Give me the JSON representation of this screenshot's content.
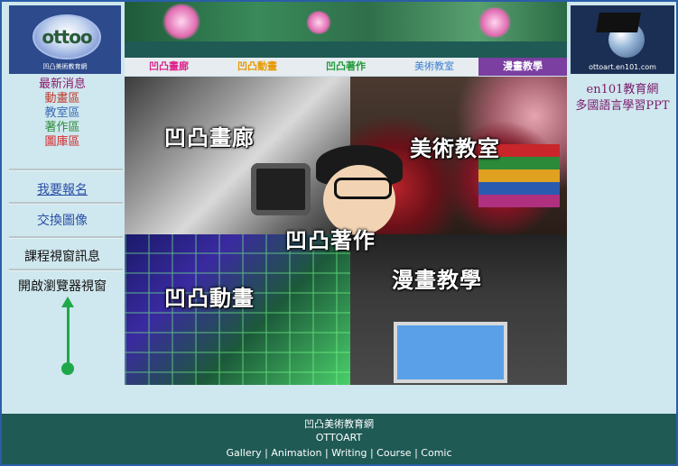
{
  "left_sidebar": {
    "logo_text": "ottoo",
    "logo_caption": "凹凸美術教育網",
    "nav": {
      "latest": "最新消息",
      "animation": "動畫區",
      "classroom": "教室區",
      "works": "著作區",
      "gallery": "圖庫區"
    },
    "signup": "我要報名",
    "exchange": "交換圖像",
    "course_window_msg": "課程視窗訊息",
    "open_browser_window": "開啟瀏覽器視窗"
  },
  "tabs": [
    "凹凸畫廊",
    "凹凸動畫",
    "凹凸著作",
    "美術教室",
    "漫畫教學"
  ],
  "hero": {
    "labels": [
      "凹凸畫廊",
      "美術教室",
      "凹凸著作",
      "凹凸動畫",
      "漫畫教學"
    ]
  },
  "right_sidebar": {
    "logo_caption": "ottoart.en101.com",
    "link1": "en101教育網",
    "link2": "多國語言學習PPT"
  },
  "footer": {
    "line1": "凹凸美術教育網",
    "line2": "OTTOART",
    "links": [
      "Gallery",
      "Animation",
      "Writing",
      "Course",
      "Comic"
    ],
    "separator": " | "
  },
  "colors": {
    "accent_arrow": "#1ea84a",
    "footer_bg": "#1f5a55",
    "sidebar_bg": "#cfe7ee"
  }
}
